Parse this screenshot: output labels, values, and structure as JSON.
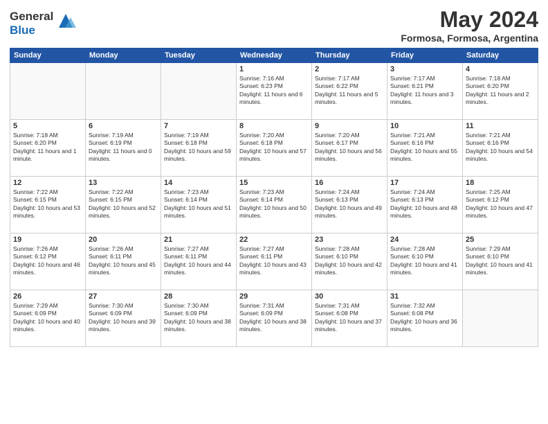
{
  "logo": {
    "general": "General",
    "blue": "Blue"
  },
  "title": "May 2024",
  "subtitle": "Formosa, Formosa, Argentina",
  "days_of_week": [
    "Sunday",
    "Monday",
    "Tuesday",
    "Wednesday",
    "Thursday",
    "Friday",
    "Saturday"
  ],
  "weeks": [
    [
      {
        "num": "",
        "info": ""
      },
      {
        "num": "",
        "info": ""
      },
      {
        "num": "",
        "info": ""
      },
      {
        "num": "1",
        "info": "Sunrise: 7:16 AM\nSunset: 6:23 PM\nDaylight: 11 hours and 6 minutes."
      },
      {
        "num": "2",
        "info": "Sunrise: 7:17 AM\nSunset: 6:22 PM\nDaylight: 11 hours and 5 minutes."
      },
      {
        "num": "3",
        "info": "Sunrise: 7:17 AM\nSunset: 6:21 PM\nDaylight: 11 hours and 3 minutes."
      },
      {
        "num": "4",
        "info": "Sunrise: 7:18 AM\nSunset: 6:20 PM\nDaylight: 11 hours and 2 minutes."
      }
    ],
    [
      {
        "num": "5",
        "info": "Sunrise: 7:18 AM\nSunset: 6:20 PM\nDaylight: 11 hours and 1 minute."
      },
      {
        "num": "6",
        "info": "Sunrise: 7:19 AM\nSunset: 6:19 PM\nDaylight: 11 hours and 0 minutes."
      },
      {
        "num": "7",
        "info": "Sunrise: 7:19 AM\nSunset: 6:18 PM\nDaylight: 10 hours and 59 minutes."
      },
      {
        "num": "8",
        "info": "Sunrise: 7:20 AM\nSunset: 6:18 PM\nDaylight: 10 hours and 57 minutes."
      },
      {
        "num": "9",
        "info": "Sunrise: 7:20 AM\nSunset: 6:17 PM\nDaylight: 10 hours and 56 minutes."
      },
      {
        "num": "10",
        "info": "Sunrise: 7:21 AM\nSunset: 6:16 PM\nDaylight: 10 hours and 55 minutes."
      },
      {
        "num": "11",
        "info": "Sunrise: 7:21 AM\nSunset: 6:16 PM\nDaylight: 10 hours and 54 minutes."
      }
    ],
    [
      {
        "num": "12",
        "info": "Sunrise: 7:22 AM\nSunset: 6:15 PM\nDaylight: 10 hours and 53 minutes."
      },
      {
        "num": "13",
        "info": "Sunrise: 7:22 AM\nSunset: 6:15 PM\nDaylight: 10 hours and 52 minutes."
      },
      {
        "num": "14",
        "info": "Sunrise: 7:23 AM\nSunset: 6:14 PM\nDaylight: 10 hours and 51 minutes."
      },
      {
        "num": "15",
        "info": "Sunrise: 7:23 AM\nSunset: 6:14 PM\nDaylight: 10 hours and 50 minutes."
      },
      {
        "num": "16",
        "info": "Sunrise: 7:24 AM\nSunset: 6:13 PM\nDaylight: 10 hours and 49 minutes."
      },
      {
        "num": "17",
        "info": "Sunrise: 7:24 AM\nSunset: 6:13 PM\nDaylight: 10 hours and 48 minutes."
      },
      {
        "num": "18",
        "info": "Sunrise: 7:25 AM\nSunset: 6:12 PM\nDaylight: 10 hours and 47 minutes."
      }
    ],
    [
      {
        "num": "19",
        "info": "Sunrise: 7:26 AM\nSunset: 6:12 PM\nDaylight: 10 hours and 46 minutes."
      },
      {
        "num": "20",
        "info": "Sunrise: 7:26 AM\nSunset: 6:11 PM\nDaylight: 10 hours and 45 minutes."
      },
      {
        "num": "21",
        "info": "Sunrise: 7:27 AM\nSunset: 6:11 PM\nDaylight: 10 hours and 44 minutes."
      },
      {
        "num": "22",
        "info": "Sunrise: 7:27 AM\nSunset: 6:11 PM\nDaylight: 10 hours and 43 minutes."
      },
      {
        "num": "23",
        "info": "Sunrise: 7:28 AM\nSunset: 6:10 PM\nDaylight: 10 hours and 42 minutes."
      },
      {
        "num": "24",
        "info": "Sunrise: 7:28 AM\nSunset: 6:10 PM\nDaylight: 10 hours and 41 minutes."
      },
      {
        "num": "25",
        "info": "Sunrise: 7:29 AM\nSunset: 6:10 PM\nDaylight: 10 hours and 41 minutes."
      }
    ],
    [
      {
        "num": "26",
        "info": "Sunrise: 7:29 AM\nSunset: 6:09 PM\nDaylight: 10 hours and 40 minutes."
      },
      {
        "num": "27",
        "info": "Sunrise: 7:30 AM\nSunset: 6:09 PM\nDaylight: 10 hours and 39 minutes."
      },
      {
        "num": "28",
        "info": "Sunrise: 7:30 AM\nSunset: 6:09 PM\nDaylight: 10 hours and 38 minutes."
      },
      {
        "num": "29",
        "info": "Sunrise: 7:31 AM\nSunset: 6:09 PM\nDaylight: 10 hours and 38 minutes."
      },
      {
        "num": "30",
        "info": "Sunrise: 7:31 AM\nSunset: 6:08 PM\nDaylight: 10 hours and 37 minutes."
      },
      {
        "num": "31",
        "info": "Sunrise: 7:32 AM\nSunset: 6:08 PM\nDaylight: 10 hours and 36 minutes."
      },
      {
        "num": "",
        "info": ""
      }
    ]
  ]
}
